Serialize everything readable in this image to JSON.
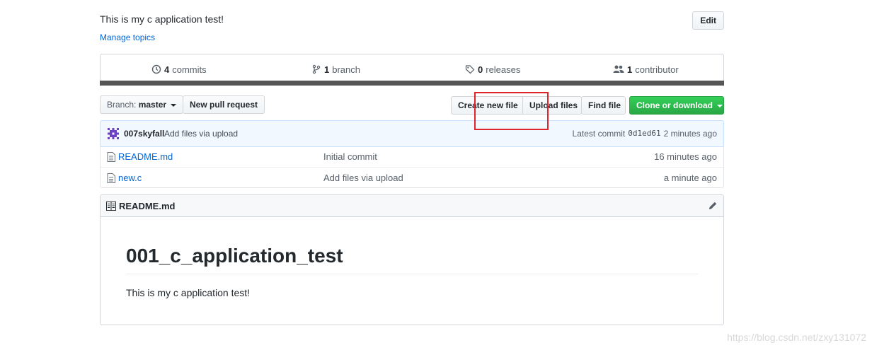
{
  "repo": {
    "description": "This is my c application test!",
    "edit_label": "Edit",
    "manage_topics_label": "Manage topics"
  },
  "summary": {
    "commits_count": "4",
    "commits_label": "commits",
    "branch_count": "1",
    "branch_label": "branch",
    "releases_count": "0",
    "releases_label": "releases",
    "contributor_count": "1",
    "contributor_label": "contributor"
  },
  "file_nav": {
    "branch_prefix": "Branch:",
    "branch_name": "master",
    "new_pull_request_label": "New pull request",
    "create_new_file_label": "Create new file",
    "upload_files_label": "Upload files",
    "find_file_label": "Find file",
    "clone_label": "Clone or download"
  },
  "latest_commit": {
    "author": "007skyfall",
    "message": "Add files via upload",
    "prefix": "Latest commit",
    "sha": "0d1ed61",
    "age": "2 minutes ago"
  },
  "files": [
    {
      "name": "README.md",
      "message": "Initial commit",
      "age": "16 minutes ago"
    },
    {
      "name": "new.c",
      "message": "Add files via upload",
      "age": "a minute ago"
    }
  ],
  "readme": {
    "header": "README.md",
    "h1": "001_c_application_test",
    "paragraph": "This is my c application test!"
  },
  "watermark": "https://blog.csdn.net/zxy131072",
  "colors": {
    "link": "#0366d6",
    "green": "#28a745",
    "highlight": "#e1242b",
    "avatar": "#6f42c1"
  }
}
